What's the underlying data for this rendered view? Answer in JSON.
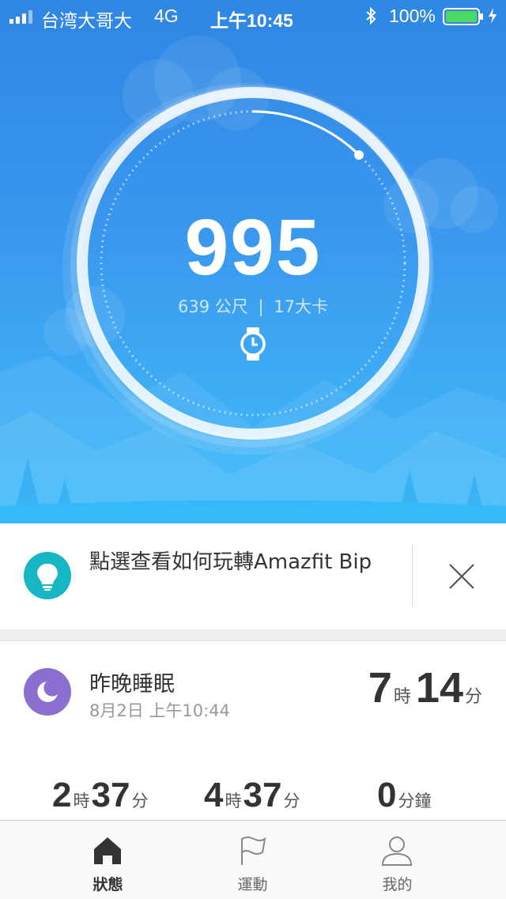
{
  "status_bar": {
    "carrier": "台湾大哥大",
    "network": "4G",
    "time": "上午10:45",
    "battery": "100%"
  },
  "activity": {
    "steps": "995",
    "distance": "639 公尺",
    "separator": "|",
    "calories": "17大卡",
    "goal_progress": 0.1
  },
  "tip": {
    "text": "點選查看如何玩轉Amazfit Bip"
  },
  "sleep": {
    "title": "昨晚睡眠",
    "date": "8月2日 上午10:44",
    "total": {
      "hours": "7",
      "hours_unit": "時",
      "minutes": "14",
      "minutes_unit": "分"
    },
    "breakdown": [
      {
        "hours": "2",
        "hours_unit": "時",
        "minutes": "37",
        "minutes_unit": "分"
      },
      {
        "hours": "4",
        "hours_unit": "時",
        "minutes": "37",
        "minutes_unit": "分"
      },
      {
        "value": "0",
        "unit": "分鐘"
      }
    ]
  },
  "tabs": [
    {
      "label": "狀態",
      "icon": "home-icon",
      "active": true
    },
    {
      "label": "運動",
      "icon": "flag-icon",
      "active": false
    },
    {
      "label": "我的",
      "icon": "person-icon",
      "active": false
    }
  ],
  "colors": {
    "hero_top": "#2f86e3",
    "hero_bottom": "#36b8fb",
    "tip_icon": "#16b6c4",
    "sleep_icon": "#8a6fd0",
    "battery": "#4cd964"
  }
}
